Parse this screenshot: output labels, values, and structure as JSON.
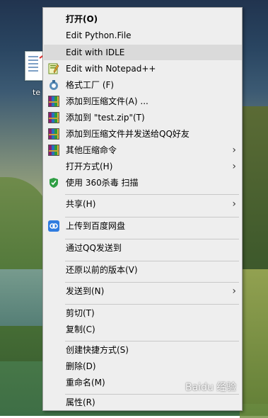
{
  "desktop": {
    "file_label": "te"
  },
  "menu": {
    "items": [
      {
        "label": "打开(O)",
        "icon": null,
        "bold": true
      },
      {
        "label": "Edit Python.File",
        "icon": null
      },
      {
        "label": "Edit with IDLE",
        "icon": null,
        "highlight": true
      },
      {
        "label": "Edit with Notepad++",
        "icon": "notepad-plus-plus-icon"
      },
      {
        "label": "格式工厂 (F)",
        "icon": "format-factory-icon"
      },
      {
        "label": "添加到压缩文件(A) ...",
        "icon": "winrar-icon"
      },
      {
        "label": "添加到 \"test.zip\"(T)",
        "icon": "winrar-icon"
      },
      {
        "label": "添加到压缩文件并发送给QQ好友",
        "icon": "winrar-icon"
      },
      {
        "label": "其他压缩命令",
        "icon": "winrar-icon",
        "submenu": true
      },
      {
        "label": "打开方式(H)",
        "icon": null,
        "submenu": true
      },
      {
        "label": "使用 360杀毒 扫描",
        "icon": "360-shield-icon"
      },
      {
        "label": "共享(H)",
        "icon": null,
        "submenu": true
      },
      {
        "label": "上传到百度网盘",
        "icon": "baidu-netdisk-icon"
      },
      {
        "label": "通过QQ发送到",
        "icon": null
      },
      {
        "label": "还原以前的版本(V)",
        "icon": null
      },
      {
        "label": "发送到(N)",
        "icon": null,
        "submenu": true
      },
      {
        "label": "剪切(T)",
        "icon": null
      },
      {
        "label": "复制(C)",
        "icon": null
      },
      {
        "label": "创建快捷方式(S)",
        "icon": null
      },
      {
        "label": "删除(D)",
        "icon": null
      },
      {
        "label": "重命名(M)",
        "icon": null
      },
      {
        "label": "属性(R)",
        "icon": null
      }
    ],
    "submenu_glyph": "›"
  },
  "watermark": "Baidu 经验",
  "colors": {
    "menu_bg": "#eeeeee",
    "highlight": "#dadada",
    "arrow": "#e03030"
  }
}
